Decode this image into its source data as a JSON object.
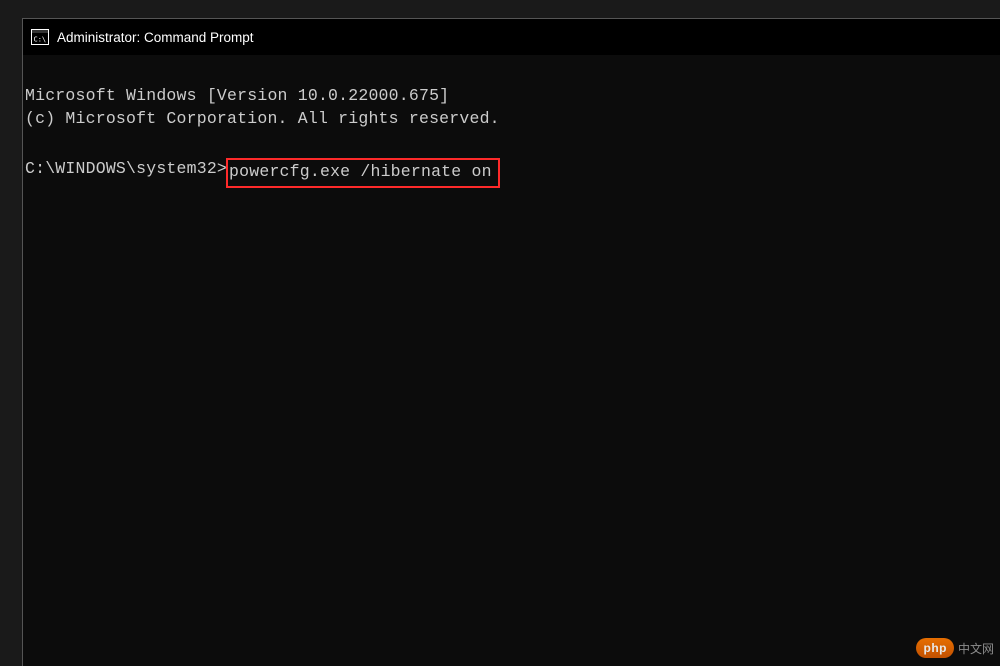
{
  "titlebar": {
    "title": "Administrator: Command Prompt"
  },
  "terminal": {
    "line1": "Microsoft Windows [Version 10.0.22000.675]",
    "line2": "(c) Microsoft Corporation. All rights reserved.",
    "prompt": "C:\\WINDOWS\\system32>",
    "command": "powercfg.exe /hibernate on"
  },
  "watermark": {
    "badge": "php",
    "text": "中文网"
  }
}
